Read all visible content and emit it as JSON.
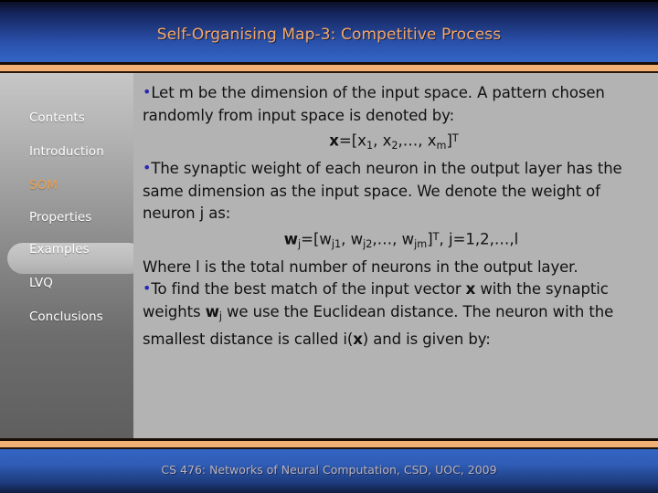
{
  "slide": {
    "title": "Self-Organising Map-3: Competitive Process",
    "footer": "CS 476: Networks of Neural Computation, CSD, UOC, 2009"
  },
  "colors": {
    "title_accent": "#f4a76a",
    "rule_orange": "#f3b074",
    "nav_active": "#f0a04a",
    "nav_text": "#ffffff",
    "bullet": "#2a2ab0",
    "body_text": "#111111",
    "content_bg": "#b3b3b3",
    "footer_text": "#bdb2b8",
    "title_bar_top": "#0a0d1e",
    "title_bar_bottom": "#3465c4"
  },
  "sidebar": {
    "items": [
      {
        "label": "Contents",
        "active": false
      },
      {
        "label": "Introduction",
        "active": false
      },
      {
        "label": "SOM",
        "active": true
      },
      {
        "label": "Properties",
        "active": false
      },
      {
        "label": "Examples",
        "active": false
      },
      {
        "label": "LVQ",
        "active": false
      },
      {
        "label": "Conclusions",
        "active": false
      }
    ]
  },
  "body": {
    "bullet_glyph": "•",
    "block1": {
      "text": "Let m be the dimension of the input space. A pattern chosen randomly from input space is denoted by:",
      "formula": {
        "lhs": "x",
        "eq": "=[",
        "t1": "x",
        "t1sub": "1",
        "t2": "x",
        "t2sub": "2",
        "ellipsis": ",…, ",
        "t3": "x",
        "t3sub": "m",
        "close": "]",
        "transpose": "T"
      }
    },
    "block2": {
      "text": "The synaptic weight of each neuron in the output layer has the same dimension as the input space. We denote the weight of neuron j as:",
      "formula": {
        "lhs": "w",
        "lhssub": "j",
        "eq": "=[",
        "t1": "w",
        "t1sub": "j1",
        "t2": "w",
        "t2sub": "j2",
        "ellipsis": ",…, ",
        "t3": "w",
        "t3sub": "jm",
        "close": "]",
        "transpose": "T",
        "tail": ",   j=1,2,…,l"
      }
    },
    "block3": {
      "text": "Where l is the total number of neurons in the output layer."
    },
    "block4": {
      "prefix": "To find the best match of the input vector ",
      "vec1": "x",
      "mid1": " with the synaptic weights ",
      "vec2": "w",
      "vec2sub": "j",
      "mid2": " we use the Euclidean distance. The neuron with the smallest distance is called i(",
      "vec3": "x",
      "suffix": ") and is given by:"
    }
  }
}
